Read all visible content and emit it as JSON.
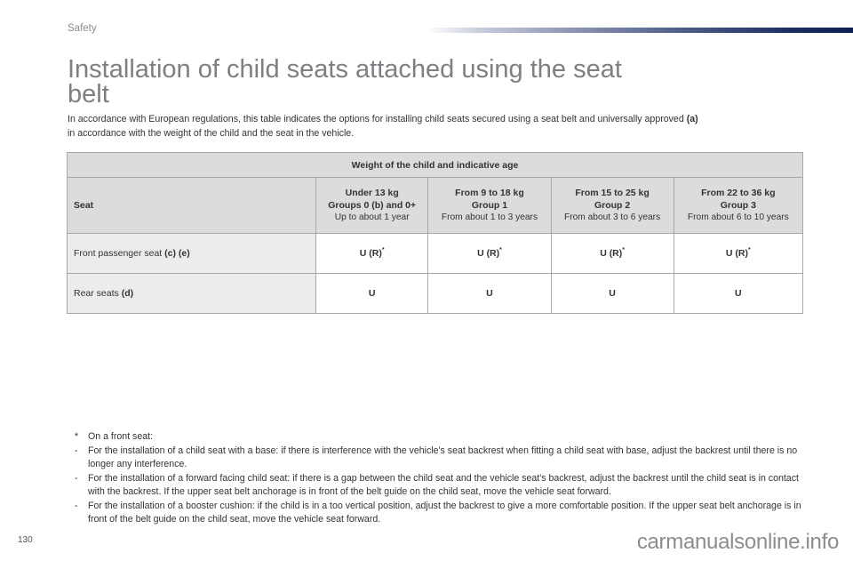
{
  "header": {
    "section": "Safety",
    "accent_color": "#0c1f55"
  },
  "title": "Installation of child seats attached using the seat belt",
  "intro": {
    "text": "In accordance with European regulations, this table indicates the options for installing child seats secured using a seat belt and universally approved",
    "note_ref": "(a)",
    "text2": "in accordance with the weight of the child and the seat in the vehicle."
  },
  "table": {
    "group_header": "Weight of the child and indicative age",
    "seat_header": "Seat",
    "columns": [
      {
        "weight": "Under 13 kg",
        "group": "Groups 0 (b) and 0+",
        "age": "Up to about 1 year"
      },
      {
        "weight": "From 9 to 18 kg",
        "group": "Group 1",
        "age": "From about 1 to 3 years"
      },
      {
        "weight": "From 15 to 25 kg",
        "group": "Group 2",
        "age": "From about 3 to 6 years"
      },
      {
        "weight": "From 22 to 36 kg",
        "group": "Group 3",
        "age": "From about 6 to 10 years"
      }
    ],
    "rows": [
      {
        "seat": "Front passenger seat",
        "notes": "(c) (e)",
        "values": [
          "U (R)",
          "U (R)",
          "U (R)",
          "U (R)"
        ],
        "sup": "*"
      },
      {
        "seat": "Rear seats",
        "notes": "(d)",
        "values": [
          "U",
          "U",
          "U",
          "U"
        ],
        "sup": ""
      }
    ]
  },
  "footnotes": {
    "star_mark": "*",
    "star_text": "On a front seat:",
    "items": [
      {
        "mark": "-",
        "text": "For the installation of a child seat with a base: if there is interference with the vehicle's seat backrest when fitting a child seat with base, adjust the backrest until there is no longer any interference."
      },
      {
        "mark": "-",
        "text": "For the installation of a forward facing child seat: if there is a gap between the child seat and the vehicle seat's backrest, adjust the backrest until the child seat is in contact with the backrest. If the upper seat belt anchorage is in front of the belt guide on the child seat, move the vehicle seat forward."
      },
      {
        "mark": "-",
        "text": "For the installation of a booster cushion: if the child is in a too vertical position, adjust the backrest to give a more comfortable position. If the upper seat belt anchorage is in front of the belt guide on the child seat, move the vehicle seat forward."
      }
    ]
  },
  "footer": {
    "page_number": "130",
    "watermark": "carmanualsonline.info"
  }
}
